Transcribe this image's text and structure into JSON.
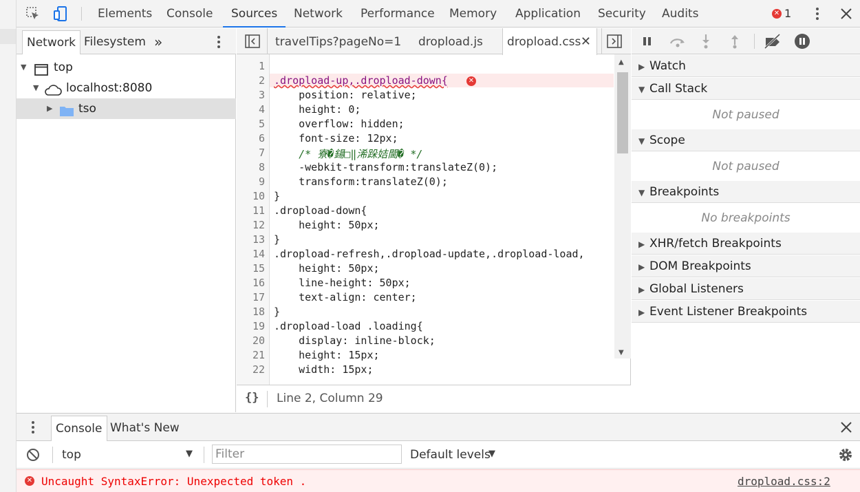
{
  "toolbar": {
    "tabs": [
      "Elements",
      "Console",
      "Sources",
      "Network",
      "Performance",
      "Memory",
      "Application",
      "Security",
      "Audits"
    ],
    "active_tab": "Sources",
    "error_count": "1"
  },
  "navigator": {
    "tabs": [
      "Network",
      "Filesystem"
    ],
    "more": "»",
    "tree": [
      "top",
      "localhost:8080",
      "tso"
    ]
  },
  "editor": {
    "tabs": [
      "travelTips?pageNo=1",
      "dropload.js",
      "dropload.css"
    ],
    "active_tab": "dropload.css",
    "line_numbers": [
      "1",
      "2",
      "3",
      "4",
      "5",
      "6",
      "7",
      "8",
      "9",
      "10",
      "11",
      "12",
      "13",
      "14",
      "15",
      "16",
      "17",
      "18",
      "19",
      "20",
      "21",
      "22"
    ],
    "lines": [
      "",
      ".dropload-up,.dropload-down{",
      "    position: relative;",
      "    height: 0;",
      "    overflow: hidden;",
      "    font-size: 12px;",
      "    /* 寮�鍚□‖浠跺姞閫� */",
      "    -webkit-transform:translateZ(0);",
      "    transform:translateZ(0);",
      "}",
      ".dropload-down{",
      "    height: 50px;",
      "}",
      ".dropload-refresh,.dropload-update,.dropload-load,",
      "    height: 50px;",
      "    line-height: 50px;",
      "    text-align: center;",
      "}",
      ".dropload-load .loading{",
      "    display: inline-block;",
      "    height: 15px;",
      "    width: 15px;"
    ],
    "status": "Line 2, Column 29",
    "format_icon": "{}"
  },
  "debugger": {
    "panes": [
      "Watch",
      "Call Stack",
      "Scope",
      "Breakpoints",
      "XHR/fetch Breakpoints",
      "DOM Breakpoints",
      "Global Listeners",
      "Event Listener Breakpoints"
    ],
    "call_stack_status": "Not paused",
    "scope_status": "Not paused",
    "breakpoints_status": "No breakpoints"
  },
  "drawer": {
    "tabs": [
      "Console",
      "What's New"
    ],
    "context": "top",
    "filter_placeholder": "Filter",
    "levels": "Default levels",
    "error_message": "Uncaught SyntaxError: Unexpected token .",
    "error_source": "dropload.css:2"
  }
}
